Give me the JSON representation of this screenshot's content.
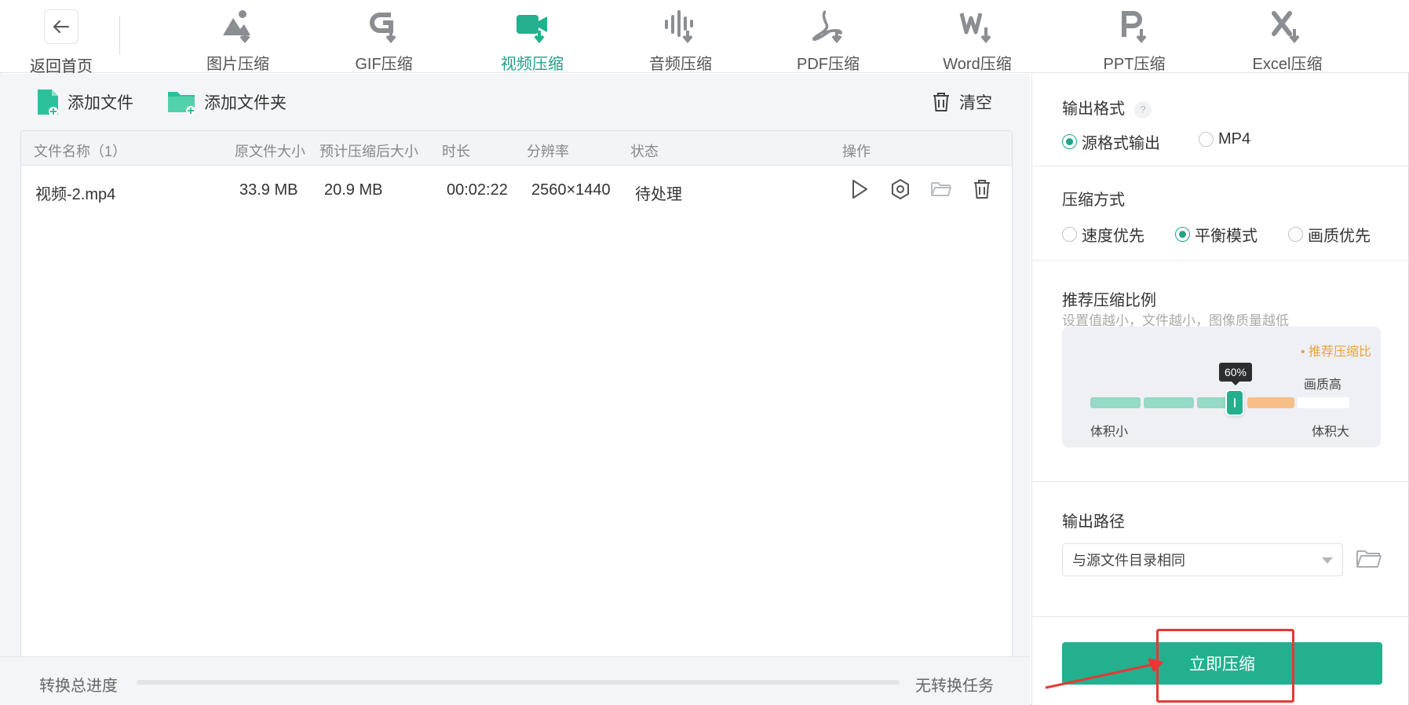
{
  "nav": {
    "back_label": "返回首页",
    "tabs": [
      {
        "label": "图片压缩",
        "icon": "image-compress-icon"
      },
      {
        "label": "GIF压缩",
        "icon": "gif-compress-icon"
      },
      {
        "label": "视频压缩",
        "icon": "video-compress-icon",
        "active": true
      },
      {
        "label": "音频压缩",
        "icon": "audio-compress-icon"
      },
      {
        "label": "PDF压缩",
        "icon": "pdf-compress-icon"
      },
      {
        "label": "Word压缩",
        "icon": "word-compress-icon"
      },
      {
        "label": "PPT压缩",
        "icon": "ppt-compress-icon"
      },
      {
        "label": "Excel压缩",
        "icon": "excel-compress-icon"
      }
    ]
  },
  "toolbar": {
    "add_file": "添加文件",
    "add_folder": "添加文件夹",
    "clear": "清空"
  },
  "table": {
    "headers": [
      "文件名称（1）",
      "原文件大小",
      "预计压缩后大小",
      "时长",
      "分辨率",
      "状态",
      "操作"
    ],
    "rows": [
      {
        "name": "视频-2.mp4",
        "orig_size": "33.9 MB",
        "est_size": "20.9 MB",
        "duration": "00:02:22",
        "resolution": "2560×1440",
        "status": "待处理"
      }
    ]
  },
  "progress": {
    "label": "转换总进度",
    "value": 0,
    "status": "无转换任务"
  },
  "settings": {
    "output_format": {
      "title": "输出格式",
      "help": "?",
      "options": [
        "源格式输出",
        "MP4"
      ],
      "selected": 0
    },
    "compress_mode": {
      "title": "压缩方式",
      "options": [
        "速度优先",
        "平衡模式",
        "画质优先"
      ],
      "selected": 1
    },
    "ratio": {
      "title": "推荐压缩比例",
      "subtitle": "设置值越小，文件越小，图像质量越低",
      "recommend_label": "• 推荐压缩比",
      "value_label": "60%",
      "value": 60,
      "quality_label": "画质高",
      "small_label": "体积小",
      "large_label": "体积大"
    },
    "output_path": {
      "title": "输出路径",
      "value": "与源文件目录相同"
    }
  },
  "action": {
    "compress_label": "立即压缩"
  },
  "colors": {
    "accent": "#22b08e",
    "accent_text": "#1f9e86",
    "recommend": "#e8a33c",
    "segment_light": "#95d9c6",
    "segment_orange": "#f6bf88",
    "highlight": "#e53935"
  }
}
